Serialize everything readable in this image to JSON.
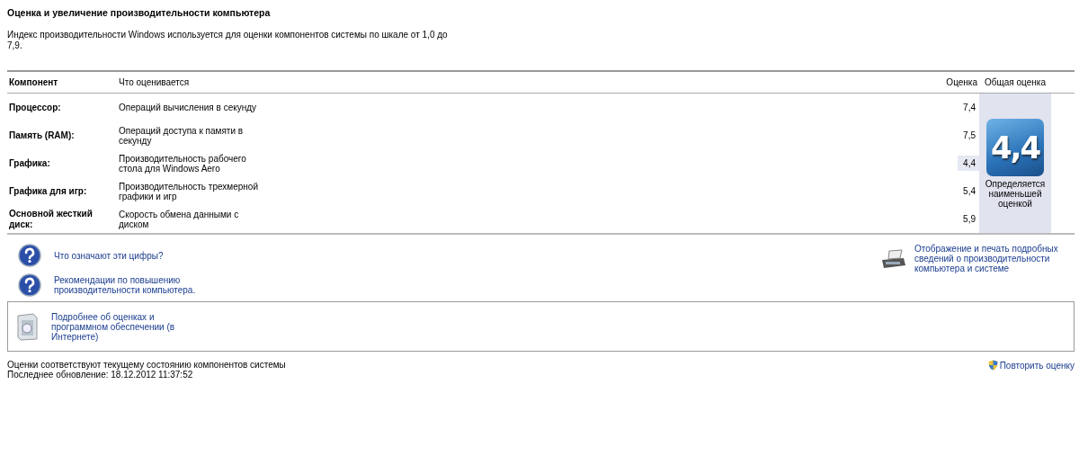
{
  "title": "Оценка и увеличение производительности компьютера",
  "intro": "Индекс производительности Windows используется для оценки компонентов системы по шкале от 1,0 до 7,9.",
  "table": {
    "columns": [
      "Компонент",
      "Что оценивается",
      "Оценка",
      "Общая оценка"
    ],
    "rows": [
      {
        "component": "Процессор:",
        "description": "Операций вычисления в секунду",
        "score": "7,4",
        "lowest": false
      },
      {
        "component": "Память (RAM):",
        "description": "Операций доступа к памяти в секунду",
        "score": "7,5",
        "lowest": false
      },
      {
        "component": "Графика:",
        "description": "Производительность рабочего стола для Windows Aero",
        "score": "4,4",
        "lowest": true
      },
      {
        "component": "Графика для игр:",
        "description": "Производительность трехмерной графики и игр",
        "score": "5,4",
        "lowest": false
      },
      {
        "component": "Основной жесткий диск:",
        "description": "Скорость обмена данными с диском",
        "score": "5,9",
        "lowest": false
      }
    ],
    "overall": {
      "score": "4,4",
      "caption": "Определяется наименьшей оценкой"
    }
  },
  "help_links": [
    {
      "text": "Что означают эти цифры?"
    },
    {
      "text": "Рекомендации по повышению производительности компьютера."
    }
  ],
  "print_link": "Отображение и печать подробных сведений о производительности компьютера и системе",
  "online_link": "Подробнее об оценках и программном обеспечении (в Интернете)",
  "status": {
    "line_1": "Оценки соответствуют текущему состоянию компонентов системы",
    "line_2": "Последнее обновление: 18.12.2012 11:37:52"
  },
  "rerun_link": "Повторить оценку"
}
